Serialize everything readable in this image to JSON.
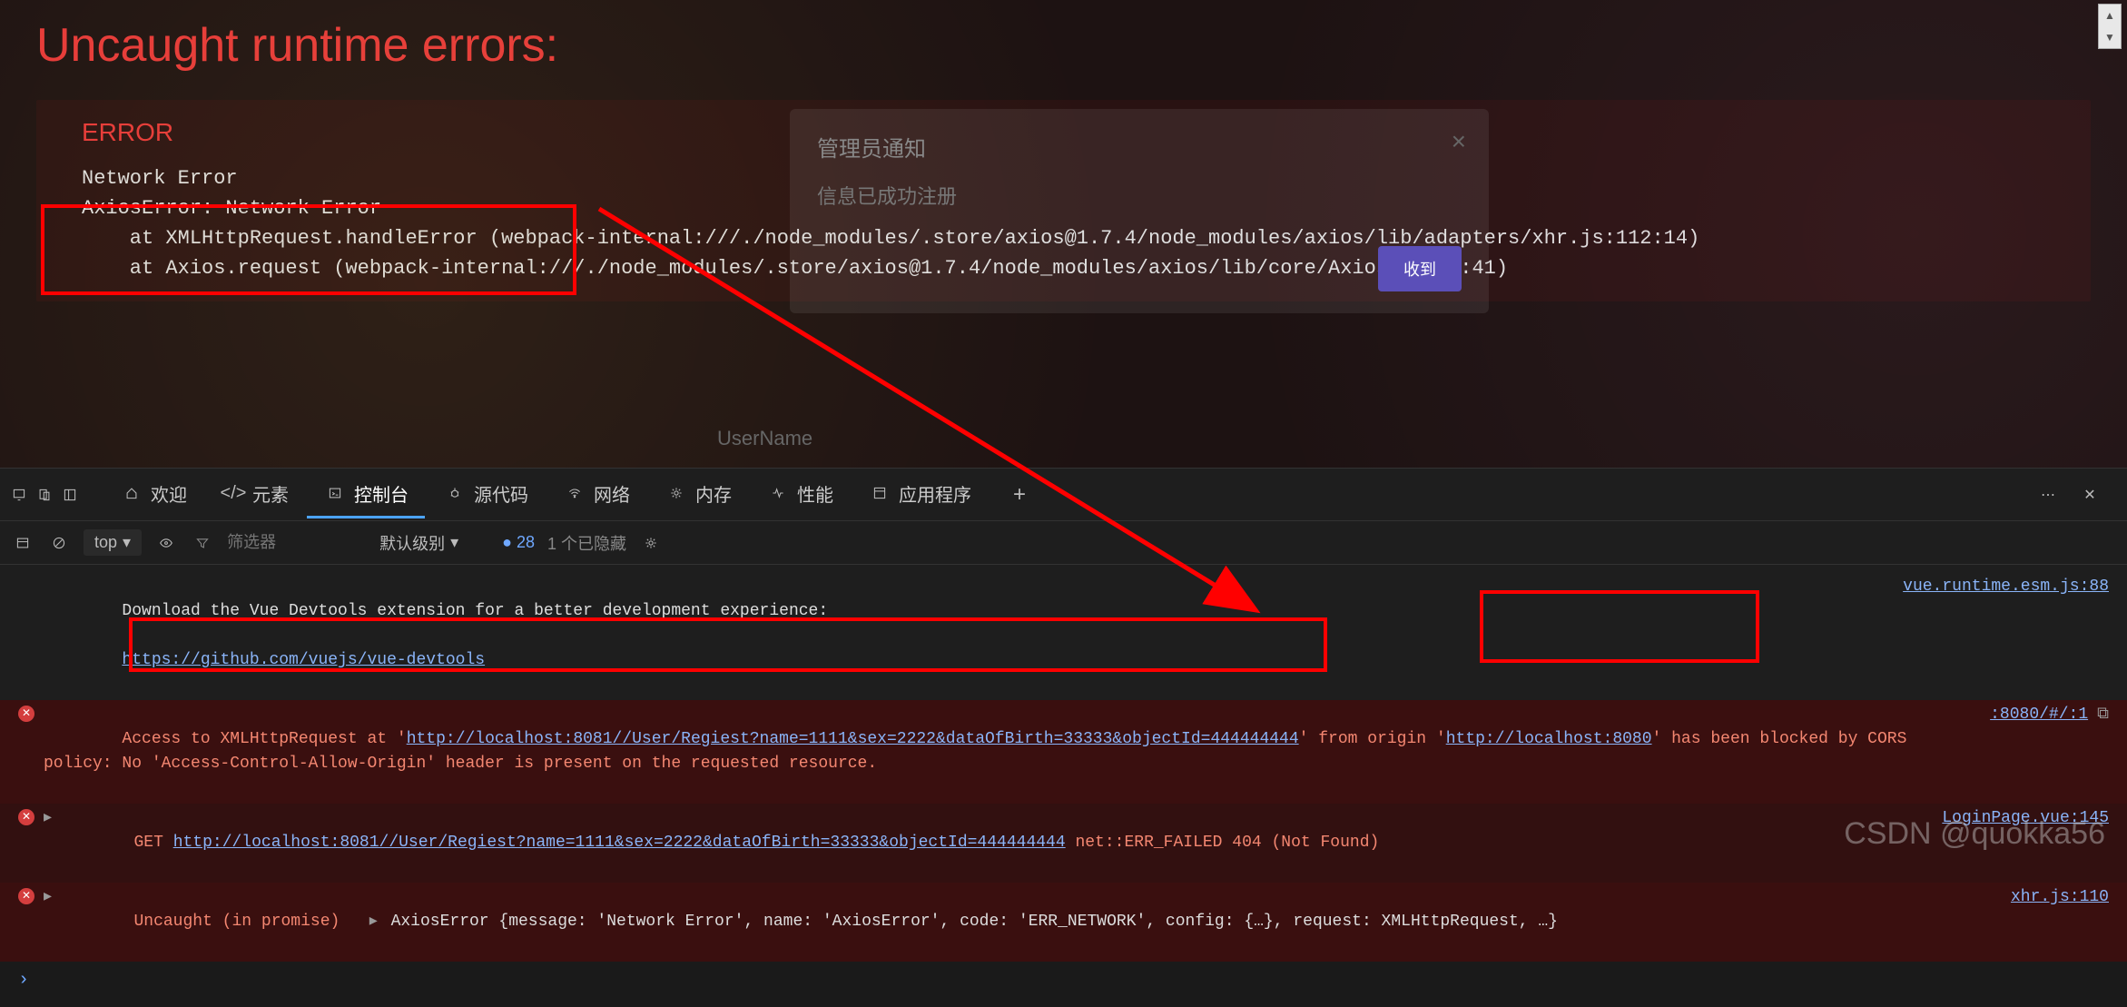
{
  "overlay": {
    "title": "Uncaught runtime errors:",
    "error_label": "ERROR",
    "error_text": "Network Error\nAxiosError: Network Error",
    "stack1": "    at XMLHttpRequest.handleError (webpack-internal:///./node_modules/.store/axios@1.7.4/node_modules/axios/lib/adapters/xhr.js:112:14)",
    "stack2": "    at Axios.request (webpack-internal:///./node_modules/.store/axios@1.7.4/node_modules/axios/lib/core/Axios.js:54:41)"
  },
  "modal": {
    "title": "管理员通知",
    "body": "信息已成功注册",
    "button": "收到",
    "close": "×"
  },
  "form": {
    "username_label": "UserName"
  },
  "devtools": {
    "tabs": {
      "welcome": "欢迎",
      "elements": "元素",
      "console": "控制台",
      "sources": "源代码",
      "network": "网络",
      "memory": "内存",
      "performance": "性能",
      "application": "应用程序"
    },
    "toolbar": {
      "context": "top",
      "filter_placeholder": "筛选器",
      "level": "默认级别",
      "issues": "28",
      "hidden": "1 个已隐藏"
    }
  },
  "console": {
    "line1a": "Download the Vue Devtools extension for a better development experience:",
    "line1b": "https://github.com/vuejs/vue-devtools",
    "src1": "vue.runtime.esm.js:88",
    "line2a": "Access to XMLHttpRequest at '",
    "line2_url1": "http://localhost:8081//User/Regiest?name=1111&sex=2222&dataOfBirth=33333&objectId=444444444",
    "line2b": "' from origin '",
    "line2_url2": "http://localhost:8080",
    "line2c": "' has been blocked by CORS policy: No 'Access-Control-Allow-Origin' header is present on the requested resource.",
    "src2": ":8080/#/:1",
    "line3a": "GET ",
    "line3_url": "http://localhost:8081//User/Regiest?name=1111&sex=2222&dataOfBirth=33333&objectId=444444444",
    "line3b": " net::ERR_FAILED 404 (Not Found)",
    "src3": "LoginPage.vue:145",
    "line4a": "Uncaught (in promise)   ",
    "line4b": "AxiosError {message: 'Network Error', name: 'AxiosError', code: 'ERR_NETWORK', config: {…}, request: XMLHttpRequest, …}",
    "src4": "xhr.js:110"
  },
  "watermark": "CSDN @quokka56"
}
